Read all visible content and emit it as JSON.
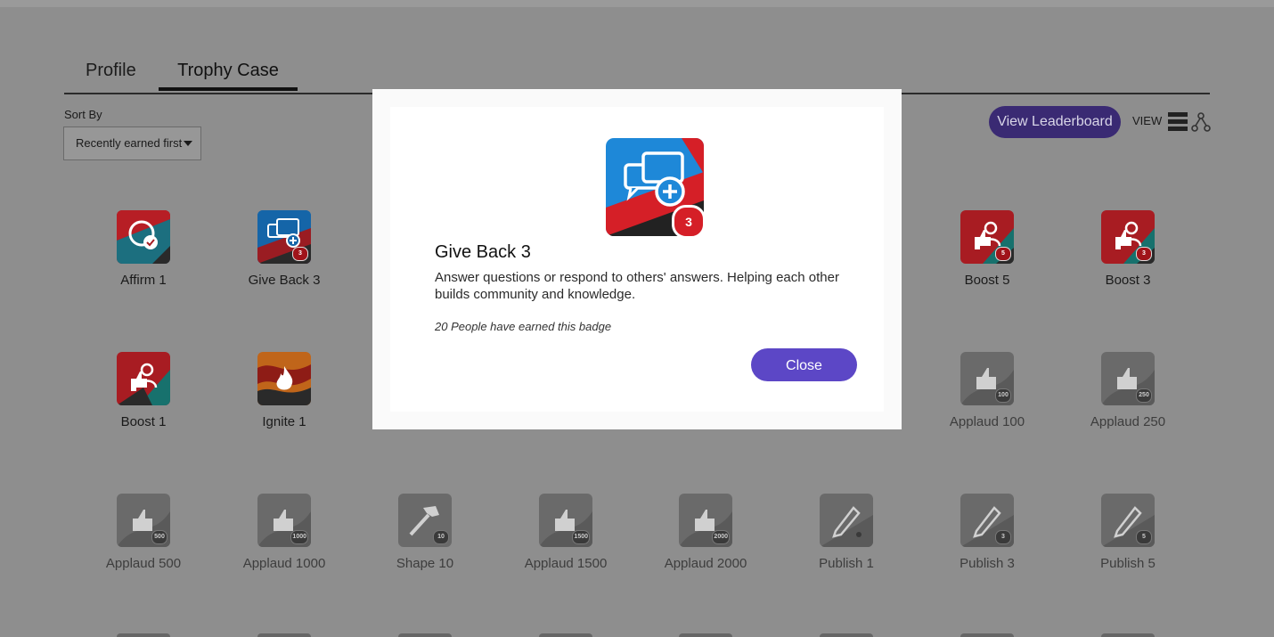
{
  "tabs": [
    "Profile",
    "Trophy Case"
  ],
  "sort": {
    "label": "Sort By",
    "selected": "Recently earned first"
  },
  "toolbar": {
    "leaderboard": "View Leaderboard",
    "view_label": "VIEW"
  },
  "badges": [
    {
      "name": "Affirm 1",
      "icon": "affirm-icon",
      "level": ""
    },
    {
      "name": "Give Back 3",
      "icon": "give-back-icon",
      "level": "3"
    },
    {
      "name": "Boost 5",
      "icon": "boost-icon",
      "level": "5"
    },
    {
      "name": "Boost 3",
      "icon": "boost-icon",
      "level": "3"
    },
    {
      "name": "Boost 1",
      "icon": "boost-icon",
      "level": ""
    },
    {
      "name": "Ignite 1",
      "icon": "ignite-icon",
      "level": ""
    },
    {
      "name": "Applaud 100",
      "icon": "thumbs-up-icon",
      "level": "100"
    },
    {
      "name": "Applaud 250",
      "icon": "thumbs-up-icon",
      "level": "250"
    },
    {
      "name": "Applaud 500",
      "icon": "thumbs-up-icon",
      "level": "500"
    },
    {
      "name": "Applaud 1000",
      "icon": "thumbs-up-icon",
      "level": "1000"
    },
    {
      "name": "Shape 10",
      "icon": "hammer-icon",
      "level": "10"
    },
    {
      "name": "Applaud 1500",
      "icon": "thumbs-up-icon",
      "level": "1500"
    },
    {
      "name": "Applaud 2000",
      "icon": "thumbs-up-icon",
      "level": "2000"
    },
    {
      "name": "Publish 1",
      "icon": "pen-icon",
      "level": ""
    },
    {
      "name": "Publish 3",
      "icon": "pen-icon",
      "level": "3"
    },
    {
      "name": "Publish 5",
      "icon": "pen-icon",
      "level": "5"
    }
  ],
  "modal": {
    "title": "Give Back 3",
    "description": "Answer questions or respond to others' answers. Helping each other builds community and knowledge.",
    "earned": "20 People have earned this badge",
    "level": "3",
    "close_label": "Close"
  },
  "colors": {
    "accent": "#5c47c6",
    "badge_red": "#d51f27",
    "badge_blue": "#1e88d8",
    "badge_teal": "#1a8a7e"
  }
}
